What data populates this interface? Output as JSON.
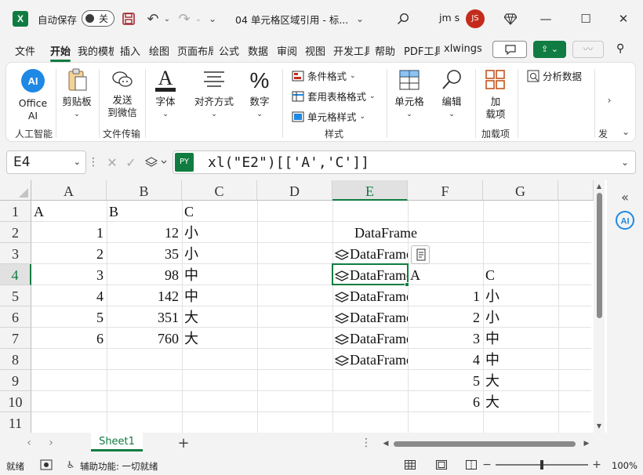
{
  "titlebar": {
    "autosave_label": "自动保存",
    "autosave_state": "关",
    "doc_title": "04 单元格区域引用 - 标...",
    "user_name": "jm s",
    "user_initials": "JS"
  },
  "tabs": [
    "文件",
    "开始",
    "我的模板",
    "插入",
    "绘图",
    "页面布局",
    "公式",
    "数据",
    "审阅",
    "视图",
    "开发工具",
    "帮助",
    "PDF工具",
    "xlwings"
  ],
  "active_tab": "开始",
  "ribbon": {
    "office_ai": "Office\nAI",
    "paste": "剪贴板",
    "send_wechat": "发送\n到微信",
    "font": "字体",
    "align": "对齐方式",
    "number": "数字",
    "cond_format": "条件格式",
    "table_format": "套用表格格式",
    "cell_style": "单元格样式",
    "cells": "单元格",
    "editing": "编辑",
    "addin": "加\n载项",
    "analysis": "分析数据",
    "groups": {
      "ai": "人工智能",
      "transfer": "文件传输",
      "styles": "样式",
      "addins": "加载项",
      "more": "发"
    }
  },
  "formula_bar": {
    "cell_ref": "E4",
    "py_badge": "PY",
    "formula": "xl(\"E2\")[['A','C']]"
  },
  "columns": [
    "A",
    "B",
    "C",
    "D",
    "E",
    "F",
    "G"
  ],
  "rows": [
    "1",
    "2",
    "3",
    "4",
    "5",
    "6",
    "7",
    "8",
    "9",
    "10",
    "11"
  ],
  "selected_cell": {
    "col": "E",
    "row": "4"
  },
  "cells": {
    "A1": "A",
    "B1": "B",
    "C1": "C",
    "A2": "1",
    "B2": "12",
    "C2": "小",
    "A3": "2",
    "B3": "35",
    "C3": "小",
    "A4": "3",
    "B4": "98",
    "C4": "中",
    "A5": "4",
    "B5": "142",
    "C5": "中",
    "A6": "5",
    "B6": "351",
    "C6": "大",
    "A7": "6",
    "B7": "760",
    "C7": "大",
    "E2": "DataFrame",
    "E3": "DataFrame",
    "E4": "DataFrame",
    "E5": "DataFrame",
    "E6": "DataFrame",
    "E7": "DataFrame",
    "E8": "DataFrame",
    "F4": "A",
    "G4": "C",
    "F5": "1",
    "G5": "小",
    "F6": "2",
    "G6": "小",
    "F7": "3",
    "G7": "中",
    "F8": "4",
    "G8": "中",
    "F9": "5",
    "G9": "大",
    "F10": "6",
    "G10": "大"
  },
  "sheet_tabs": [
    "Sheet1"
  ],
  "status": {
    "ready": "就绪",
    "accessibility": "辅助功能: 一切就绪",
    "zoom": "100%"
  },
  "colors": {
    "accent": "#107c41",
    "avatar": "#c42b1c"
  }
}
